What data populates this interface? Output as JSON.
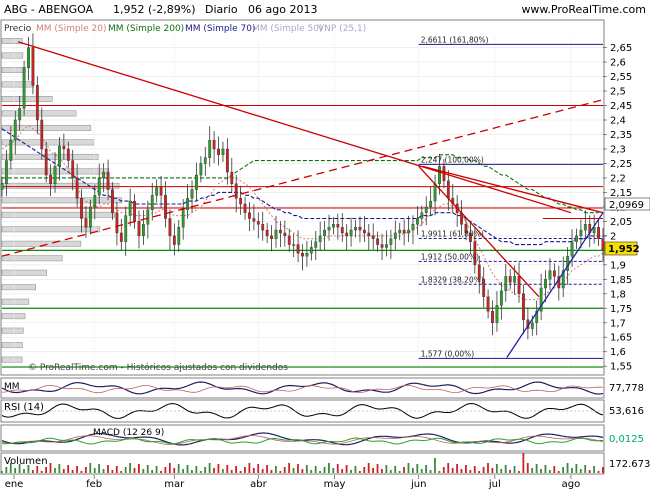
{
  "header": {
    "title": "ABG - ABENGOA",
    "price": "1,952 (-2,89%)",
    "period": "Diario",
    "date": "06 ago 2013",
    "site": "www.ProRealTime.com"
  },
  "legend": {
    "precio": "Precio",
    "mm20": "MM (Simple 20)",
    "mm200": "MM (Simple 200)",
    "mm70": "MM (Simple 70)",
    "mm50": "MM (Simple 50)",
    "vnp": "VNP (25,1)"
  },
  "watermark": "© ProRealTime.com - Históricos ajustados con dividendos",
  "fib_labels": [
    {
      "text": "2,6611 (161,80%)",
      "value": 2.6611
    },
    {
      "text": "2,247 (100,00%)",
      "value": 2.247
    },
    {
      "text": "1,9911 (61,80%)",
      "value": 1.9911
    },
    {
      "text": "1,912 (50,00%)",
      "value": 1.912
    },
    {
      "text": "1,8329 (38,20%)",
      "value": 1.8329
    },
    {
      "text": "1,577 (0,00%)",
      "value": 1.577
    }
  ],
  "price_tags": {
    "upper": "2,0969",
    "current": "1,952"
  },
  "indicators": {
    "momentum": {
      "label": "MM",
      "value": "77,778"
    },
    "rsi": {
      "label": "RSI (14)",
      "value": "53,616"
    },
    "macd": {
      "label": "MACD (12 26 9)",
      "value": "0,0125"
    },
    "volumen": {
      "label": "Volumen",
      "value": "172.673"
    }
  },
  "colors": {
    "bull": "#2aa02a",
    "bear": "#cc2222",
    "mm20": "#d08070",
    "mm200": "#0f6f0f",
    "mm70": "#1a1a8c",
    "support": "#1a1a8c",
    "resist": "#cc0000",
    "green_level": "#0a8a0a",
    "current_tag": "#f5e000"
  },
  "chart_data": {
    "type": "candlestick",
    "title": "ABG - ABENGOA",
    "x_ticks": [
      "ene",
      "feb",
      "mar",
      "abr",
      "may",
      "jun",
      "jul",
      "ago"
    ],
    "y_ticks": [
      "1,55",
      "1,6",
      "1,65",
      "1,7",
      "1,75",
      "1,8",
      "1,85",
      "1,9",
      "1,95",
      "2",
      "2,05",
      "2,1",
      "2,15",
      "2,2",
      "2,25",
      "2,3",
      "2,35",
      "2,4",
      "2,45",
      "2,5",
      "2,55",
      "2,6",
      "2,65"
    ],
    "ylim": [
      1.53,
      2.69
    ],
    "x_range": [
      0,
      150
    ],
    "month_positions": [
      3,
      23,
      43,
      64,
      83,
      104,
      123,
      142
    ],
    "closes": [
      2.18,
      2.26,
      2.33,
      2.4,
      2.44,
      2.58,
      2.65,
      2.52,
      2.4,
      2.3,
      2.21,
      2.18,
      2.24,
      2.31,
      2.3,
      2.26,
      2.2,
      2.13,
      2.06,
      2.03,
      2.1,
      2.14,
      2.2,
      2.22,
      2.16,
      2.08,
      2.01,
      1.98,
      2.07,
      2.12,
      2.05,
      2.0,
      2.04,
      2.09,
      2.14,
      2.17,
      2.14,
      2.06,
      2.0,
      1.97,
      2.03,
      2.09,
      2.13,
      2.16,
      2.21,
      2.25,
      2.27,
      2.33,
      2.3,
      2.28,
      2.3,
      2.22,
      2.18,
      2.13,
      2.11,
      2.08,
      2.06,
      2.05,
      2.04,
      2.02,
      2.0,
      1.99,
      2.02,
      2.01,
      2.0,
      1.97,
      1.97,
      1.94,
      1.93,
      1.94,
      1.96,
      1.98,
      2.0,
      2.02,
      2.03,
      2.04,
      2.03,
      2.01,
      2.0,
      2.02,
      2.03,
      2.02,
      2.01,
      2.0,
      1.99,
      1.97,
      1.96,
      1.97,
      1.99,
      2.01,
      2.02,
      2.01,
      2.02,
      2.04,
      2.06,
      2.08,
      2.1,
      2.12,
      2.18,
      2.24,
      2.19,
      2.13,
      2.11,
      2.08,
      2.04,
      2.01,
      1.98,
      1.9,
      1.85,
      1.79,
      1.74,
      1.7,
      1.76,
      1.81,
      1.86,
      1.84,
      1.86,
      1.8,
      1.71,
      1.68,
      1.7,
      1.74,
      1.82,
      1.85,
      1.88,
      1.86,
      1.82,
      1.88,
      1.93,
      1.98,
      2.0,
      2.02,
      2.04,
      2.01,
      2.03,
      1.99,
      1.952
    ],
    "ma20": [
      2.3,
      2.31,
      2.32,
      2.33,
      2.35,
      2.37,
      2.38,
      2.37,
      2.36,
      2.34,
      2.32,
      2.29,
      2.28,
      2.27,
      2.25,
      2.23,
      2.2,
      2.17,
      2.14,
      2.12,
      2.11,
      2.1,
      2.1,
      2.11,
      2.11,
      2.1,
      2.09,
      2.08,
      2.08,
      2.08,
      2.07,
      2.07,
      2.07,
      2.07,
      2.08,
      2.08,
      2.09,
      2.09,
      2.08,
      2.07,
      2.07,
      2.07,
      2.07,
      2.08,
      2.09,
      2.1,
      2.12,
      2.14,
      2.16,
      2.18,
      2.19,
      2.2,
      2.2,
      2.2,
      2.19,
      2.18,
      2.17,
      2.15,
      2.13,
      2.11,
      2.09,
      2.07,
      2.05,
      2.04,
      2.03,
      2.02,
      2.01,
      2.0,
      1.99,
      1.99,
      1.99,
      1.99,
      1.99,
      1.99,
      2.0,
      2.0,
      2.0,
      2.0,
      2.0,
      2.0,
      2.0,
      2.0,
      2.0,
      2.0,
      2.0,
      2.0,
      2.0,
      2.0,
      2.0,
      2.0,
      2.0,
      2.01,
      2.01,
      2.02,
      2.03,
      2.04,
      2.06,
      2.08,
      2.09,
      2.1,
      2.11,
      2.11,
      2.1,
      2.09,
      2.07,
      2.05,
      2.02,
      1.99,
      1.96,
      1.93,
      1.9,
      1.87,
      1.85,
      1.83,
      1.82,
      1.81,
      1.8,
      1.79,
      1.78,
      1.78,
      1.78,
      1.78,
      1.79,
      1.8,
      1.81,
      1.82,
      1.83,
      1.84,
      1.86,
      1.88,
      1.89,
      1.9,
      1.91,
      1.92,
      1.93,
      1.93,
      1.94,
      1.94
    ],
    "ma70": [
      2.37,
      2.36,
      2.35,
      2.34,
      2.33,
      2.32,
      2.31,
      2.3,
      2.29,
      2.28,
      2.27,
      2.26,
      2.25,
      2.24,
      2.23,
      2.22,
      2.21,
      2.2,
      2.19,
      2.18,
      2.17,
      2.16,
      2.15,
      2.14,
      2.14,
      2.13,
      2.13,
      2.12,
      2.12,
      2.12,
      2.11,
      2.11,
      2.11,
      2.11,
      2.11,
      2.11,
      2.11,
      2.11,
      2.11,
      2.11,
      2.11,
      2.11,
      2.12,
      2.12,
      2.12,
      2.13,
      2.13,
      2.14,
      2.14,
      2.15,
      2.15,
      2.15,
      2.15,
      2.15,
      2.15,
      2.14,
      2.14,
      2.13,
      2.13,
      2.12,
      2.11,
      2.1,
      2.09,
      2.09,
      2.08,
      2.08,
      2.07,
      2.07,
      2.06,
      2.06,
      2.06,
      2.06,
      2.06,
      2.06,
      2.06,
      2.06,
      2.06,
      2.06,
      2.06,
      2.06,
      2.06,
      2.06,
      2.06,
      2.06,
      2.06,
      2.06,
      2.06,
      2.06,
      2.06,
      2.06,
      2.06,
      2.06,
      2.06,
      2.06,
      2.06,
      2.07,
      2.07,
      2.07,
      2.08,
      2.08,
      2.08,
      2.08,
      2.08,
      2.07,
      2.07,
      2.06,
      2.05,
      2.04,
      2.03,
      2.02,
      2.01,
      2.0,
      1.99,
      1.98,
      1.98,
      1.98,
      1.97,
      1.97,
      1.97,
      1.97,
      1.97,
      1.97,
      1.97,
      1.98,
      1.98,
      1.98,
      1.98,
      1.98,
      1.98,
      1.98,
      1.99,
      1.99,
      1.99,
      2.0,
      2.0,
      2.0,
      2.0,
      2.0
    ],
    "ma200": [
      2.2,
      2.2,
      2.2,
      2.2,
      2.2,
      2.2,
      2.2,
      2.2,
      2.2,
      2.2,
      2.2,
      2.2,
      2.2,
      2.2,
      2.2,
      2.2,
      2.2,
      2.2,
      2.2,
      2.2,
      2.2,
      2.2,
      2.2,
      2.2,
      2.2,
      2.2,
      2.2,
      2.2,
      2.2,
      2.2,
      2.2,
      2.2,
      2.2,
      2.2,
      2.2,
      2.2,
      2.2,
      2.2,
      2.2,
      2.2,
      2.2,
      2.2,
      2.2,
      2.2,
      2.2,
      2.2,
      2.2,
      2.2,
      2.2,
      2.2,
      2.2,
      2.2,
      2.21,
      2.22,
      2.23,
      2.24,
      2.25,
      2.26,
      2.26,
      2.26,
      2.26,
      2.26,
      2.26,
      2.26,
      2.26,
      2.26,
      2.26,
      2.26,
      2.26,
      2.26,
      2.26,
      2.26,
      2.26,
      2.26,
      2.26,
      2.26,
      2.26,
      2.26,
      2.26,
      2.26,
      2.26,
      2.26,
      2.26,
      2.26,
      2.26,
      2.26,
      2.26,
      2.26,
      2.26,
      2.26,
      2.26,
      2.26,
      2.26,
      2.26,
      2.26,
      2.27,
      2.27,
      2.27,
      2.27,
      2.28,
      2.28,
      2.28,
      2.28,
      2.27,
      2.27,
      2.27,
      2.26,
      2.26,
      2.25,
      2.24,
      2.24,
      2.23,
      2.22,
      2.21,
      2.21,
      2.2,
      2.19,
      2.18,
      2.17,
      2.16,
      2.16,
      2.15,
      2.14,
      2.13,
      2.13,
      2.12,
      2.11,
      2.11,
      2.1,
      2.1,
      2.09,
      2.09,
      2.08,
      2.08,
      2.08,
      2.08
    ],
    "horizontal_levels": {
      "resistance_red": [
        2.45,
        2.17,
        2.096,
        2.06
      ],
      "fibonacci_blue": [
        2.6611,
        2.247,
        1.9911,
        1.912,
        1.8329,
        1.577
      ],
      "green": [
        1.95,
        1.75,
        1.547
      ]
    },
    "trendlines": [
      {
        "kind": "downtrend",
        "from": [
          4,
          2.67
        ],
        "to": [
          142,
          2.08
        ]
      },
      {
        "kind": "downtrend_short",
        "from": [
          105,
          2.24
        ],
        "to": [
          150,
          2.08
        ]
      },
      {
        "kind": "downtrend_steep",
        "from": [
          104,
          2.24
        ],
        "to": [
          134,
          1.79
        ]
      },
      {
        "kind": "uptrend_dashed",
        "from": [
          0,
          1.93
        ],
        "to": [
          150,
          2.47
        ]
      },
      {
        "kind": "uptrend_blue",
        "from": [
          126,
          1.58
        ],
        "to": [
          150,
          2.08
        ]
      }
    ],
    "fibonacci_range": [
      1.577,
      2.247
    ]
  }
}
